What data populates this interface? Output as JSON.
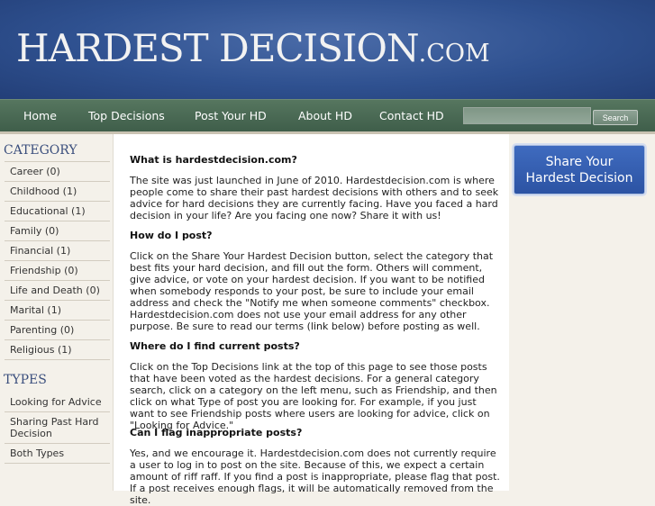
{
  "header": {
    "logo_main": "HARDEST DECISION",
    "logo_tld": ".COM"
  },
  "nav": {
    "items": [
      "Home",
      "Top Decisions",
      "Post Your HD",
      "About HD",
      "Contact HD"
    ],
    "search_value": "",
    "search_button": "Search"
  },
  "sidebar": {
    "category_heading": "CATEGORY",
    "categories": [
      "Career  (0)",
      "Childhood  (1)",
      "Educational  (1)",
      "Family  (0)",
      "Financial  (1)",
      "Friendship  (0)",
      "Life and Death  (0)",
      "Marital  (1)",
      "Parenting  (0)",
      "Religious  (1)"
    ],
    "types_heading": "TYPES",
    "types": [
      "Looking for Advice",
      "Sharing Past Hard Decision",
      "Both Types"
    ]
  },
  "right": {
    "share_line1": "Share Your",
    "share_line2": "Hardest Decision"
  },
  "content": {
    "faq": [
      {
        "q": "What is hardestdecision.com?",
        "a": "The site was just launched in June of 2010. Hardestdecision.com is where people come to share their past hardest decisions with others and to seek advice for hard decisions they are currently facing.  Have you faced a hard decision in your life?  Are you facing one now?  Share it with us!"
      },
      {
        "q": "How do I post?",
        "a": "Click on the Share Your Hardest Decision button, select the category that best fits your hard decision, and fill out the form.  Others will comment, give advice, or vote on your hardest decision.  If you want to be notified when somebody responds to your post, be sure to include your email address and check the \"Notify me when someone comments\" checkbox.  Hardestdecision.com does not use your email address for any other purpose.  Be sure to read our terms (link below) before posting as well."
      },
      {
        "q": "Where do I find current posts?",
        "a": "Click on the Top Decisions link at the top of this page to see those posts that have been voted as the hardest decisions.  For a general category search, click on a category on the left menu, such as Friendship, and then click on what Type of post you are looking for.  For example, if you just want to see Friendship posts where users are looking for advice, click on \"Looking for Advice.\""
      },
      {
        "q": "Can I flag inappropriate posts?",
        "a": "Yes, and we encourage it. Hardestdecision.com does not currently require a user to log in to post on the site.  Because of this, we expect a certain amount of riff raff.  If you find a post is inappropriate, please flag that post.  If a post receives enough flags, it will be automatically removed from the site."
      }
    ]
  }
}
